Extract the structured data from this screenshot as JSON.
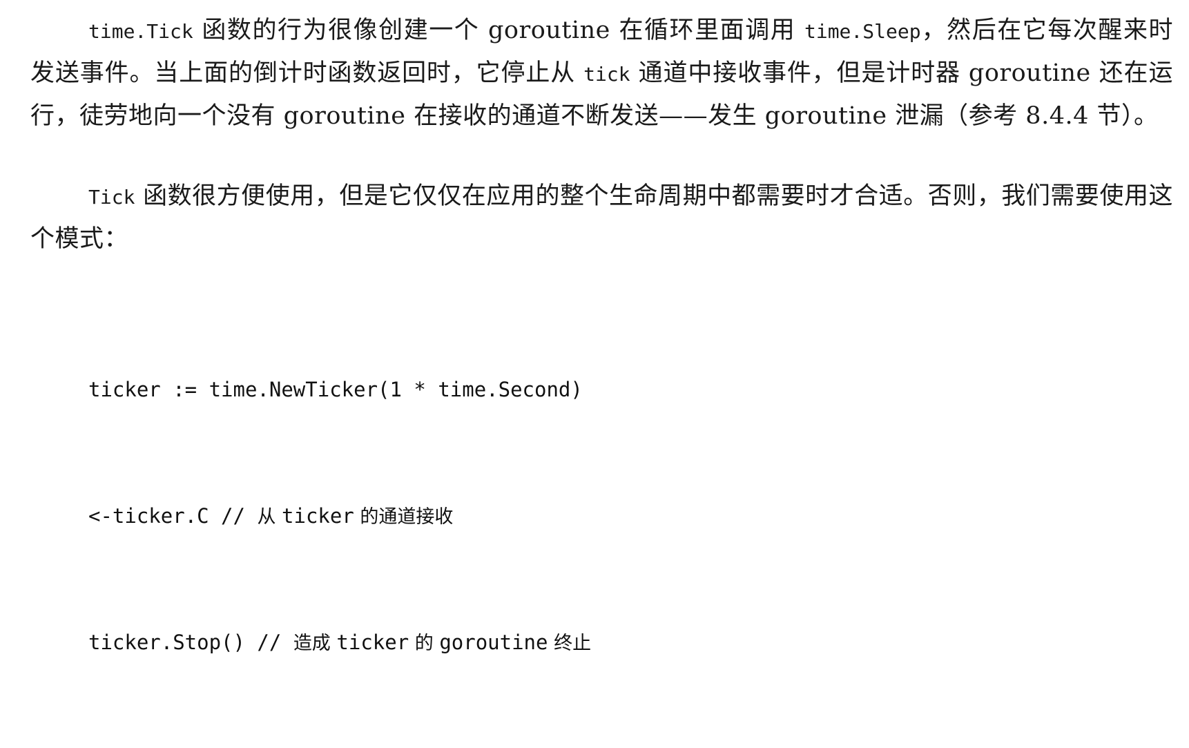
{
  "paragraph1": {
    "code_time_tick": "time.Tick",
    "text_a": " 函数的行为很像创建一个 goroutine 在循环里面调用 ",
    "code_time_sleep": "time.Sleep",
    "text_b": "，然后在它每次醒来时发送事件。当上面的倒计时函数返回时，它停止从 ",
    "code_tick": "tick",
    "text_c": " 通道中接收事件，但是计时器 goroutine 还在运行，徒劳地向一个没有 goroutine 在接收的通道不断发送——发生 goroutine 泄漏（参考 8.4.4 节）。"
  },
  "paragraph2": {
    "code_tick_func": "Tick",
    "text": " 函数很方便使用，但是它仅仅在应用的整个生命周期中都需要时才合适。否则，我们需要使用这个模式："
  },
  "code_block": {
    "line1": "ticker := time.NewTicker(1 * time.Second)",
    "line2_code": "<-ticker.C // ",
    "line2_comment_a": "从 ",
    "line2_comment_code": "ticker",
    "line2_comment_b": " 的通道接收",
    "line3_code": "ticker.Stop() // ",
    "line3_comment_a": "造成 ",
    "line3_comment_code": "ticker",
    "line3_comment_b": " 的 ",
    "line3_comment_code2": "goroutine",
    "line3_comment_c": " 终止"
  }
}
